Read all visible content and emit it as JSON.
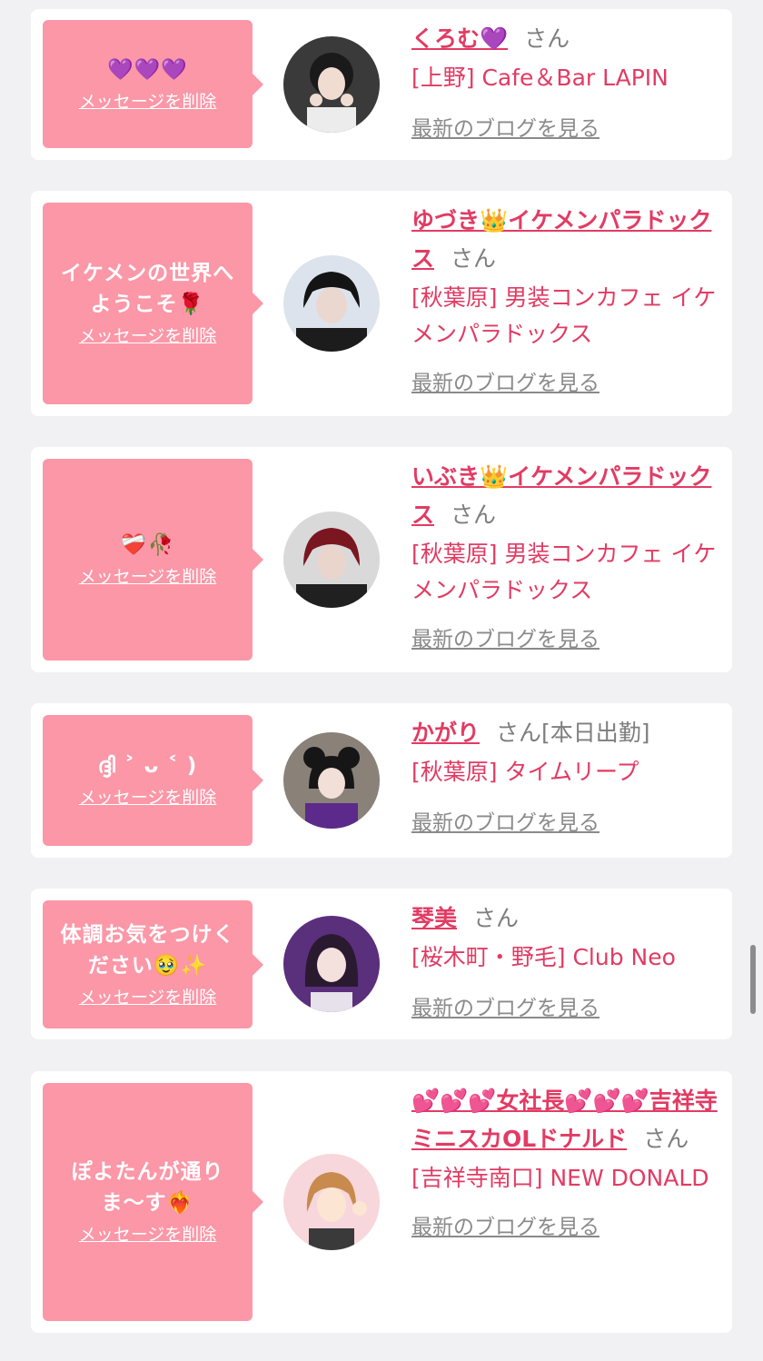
{
  "delete_label": "メッセージを削除",
  "blog_label": "最新のブログを見る",
  "san_suffix": "さん",
  "cards": [
    {
      "message": "💜💜💜",
      "name": "くろむ💜",
      "suffix_extra": "",
      "shop": "[上野] Cafe＆Bar LAPIN"
    },
    {
      "message": "イケメンの世界へようこそ🌹",
      "name": "ゆづき👑イケメンパラドックス",
      "suffix_extra": "",
      "shop": "[秋葉原] 男装コンカフェ イケメンパラドックス"
    },
    {
      "message": "❤️‍🩹🥀",
      "name": "いぶき👑イケメンパラドックス",
      "suffix_extra": "",
      "shop": "[秋葉原] 男装コンカフェ イケメンパラドックス"
    },
    {
      "message": "ദ്ദി ˃ ᴗ ˂ )",
      "name": "かがり",
      "suffix_extra": "[本日出勤]",
      "shop": "[秋葉原] タイムリープ"
    },
    {
      "message": "体調お気をつけください🥹✨",
      "name": "琴美",
      "suffix_extra": "",
      "shop": "[桜木町・野毛] Club Neo"
    },
    {
      "message": "ぽよたんが通りま〜す❤️‍🔥",
      "name": "💕💕💕女社長💕💕💕吉祥寺ミニスカOLドナルド",
      "suffix_extra": "",
      "shop": "[吉祥寺南口] NEW DONALD"
    }
  ],
  "colors": {
    "accent": "#e23b63",
    "bubble": "#fb97a7",
    "background": "#f1f1f3"
  }
}
